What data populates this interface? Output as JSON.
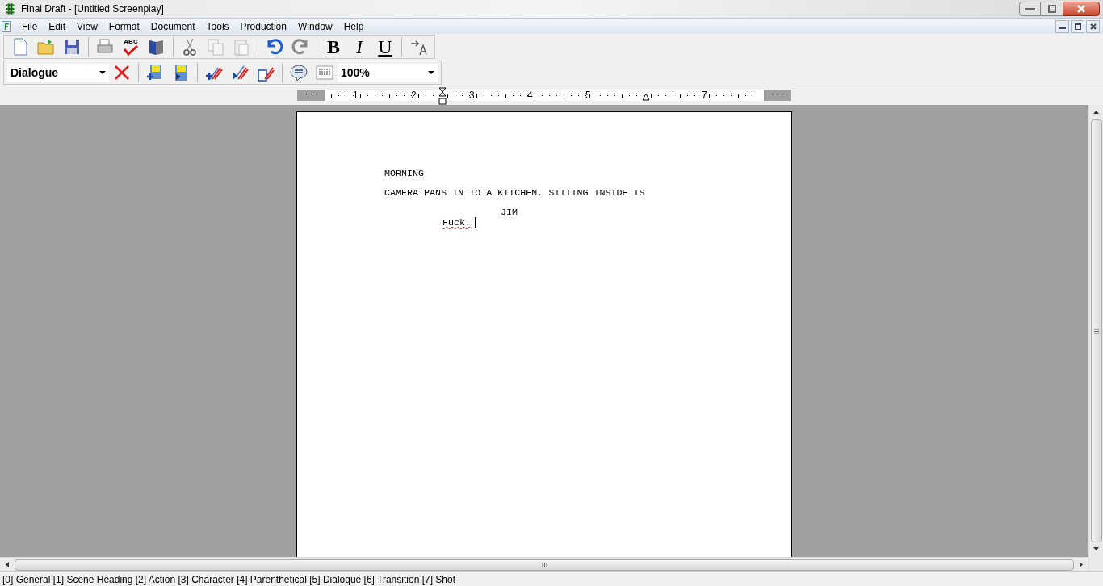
{
  "window": {
    "title": "Final Draft - [Untitled Screenplay]"
  },
  "menu": [
    "File",
    "Edit",
    "View",
    "Format",
    "Document",
    "Tools",
    "Production",
    "Window",
    "Help"
  ],
  "spelling_label": "ABC",
  "toolbar_format": {
    "bold": "B",
    "italic": "I",
    "underline": "U"
  },
  "element_dropdown": {
    "value": "Dialogue"
  },
  "zoom_dropdown": {
    "value": "100%"
  },
  "ruler": {
    "ends": "· · ·",
    "numbers": [
      "1",
      "2",
      "3",
      "4",
      "5",
      "7"
    ]
  },
  "script": [
    {
      "kind": "scene_heading",
      "text": "MORNING",
      "misspelled": false
    },
    {
      "kind": "action",
      "text": "CAMERA PANS IN TO A KITCHEN. SITTING INSIDE IS",
      "misspelled": false
    },
    {
      "kind": "character",
      "text": "JIM",
      "misspelled": false
    },
    {
      "kind": "dialogue",
      "text": "Fuck.",
      "misspelled": true,
      "cursor": true
    }
  ],
  "status_bar": "[0] General [1] Scene Heading [2] Action [3] Character [4] Parenthetical [5] Dialoque [6] Transition [7] Shot"
}
